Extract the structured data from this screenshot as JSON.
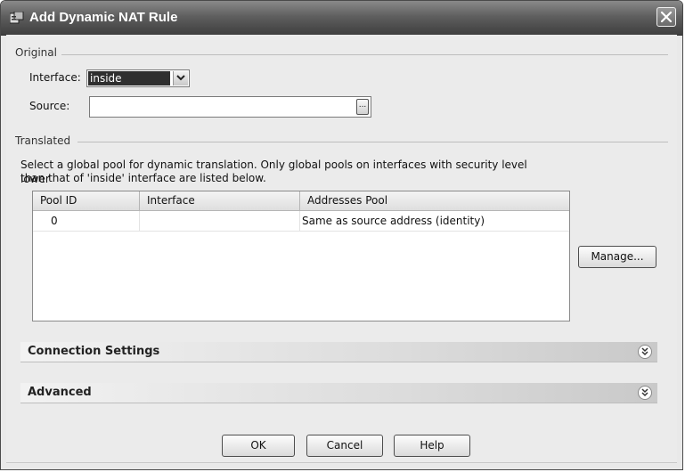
{
  "window": {
    "title": "Add Dynamic NAT Rule"
  },
  "original": {
    "group_label": "Original",
    "interface_label": "Interface:",
    "interface_value": "inside",
    "source_label": "Source:",
    "source_value": "",
    "browse_label": "..."
  },
  "translated": {
    "group_label": "Translated",
    "description_line1": "Select a global pool for dynamic translation. Only global pools on interfaces with security level lower",
    "description_line2": "than that of 'inside' interface are listed below.",
    "table": {
      "columns": [
        "Pool ID",
        "Interface",
        "Addresses Pool"
      ],
      "rows": [
        {
          "pool_id": "0",
          "interface": "",
          "addresses_pool": "Same as source address (identity)"
        }
      ]
    },
    "manage_label": "Manage..."
  },
  "sections": {
    "connection_settings": "Connection Settings",
    "advanced": "Advanced"
  },
  "footer": {
    "ok_label": "OK",
    "cancel_label": "Cancel",
    "help_label": "Help"
  }
}
